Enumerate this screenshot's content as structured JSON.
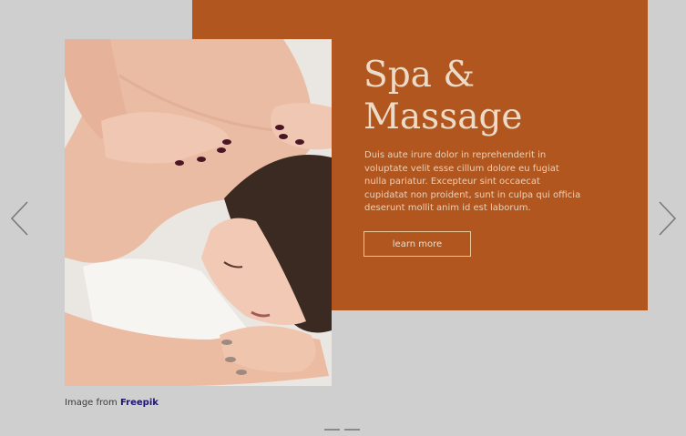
{
  "slide": {
    "title_line1": "Spa &",
    "title_line2": "Massage",
    "description": "Duis aute irure dolor in reprehenderit in voluptate velit esse cillum dolore eu fugiat nulla pariatur. Excepteur sint occaecat cupidatat non proident, sunt in culpa qui officia deserunt mollit anim id est laborum.",
    "button_label": "learn more",
    "image_subject": "woman receiving back massage",
    "credit_prefix": "Image from",
    "credit_link": "Freepik"
  },
  "navigation": {
    "prev_icon": "chevron-left-icon",
    "next_icon": "chevron-right-icon",
    "indicator_count": 2
  },
  "colors": {
    "background": "#cfcfd0",
    "panel": "#b2561f",
    "title": "#ecdcc7",
    "button_border": "#e8c79f",
    "credit_link": "#1c1670"
  }
}
